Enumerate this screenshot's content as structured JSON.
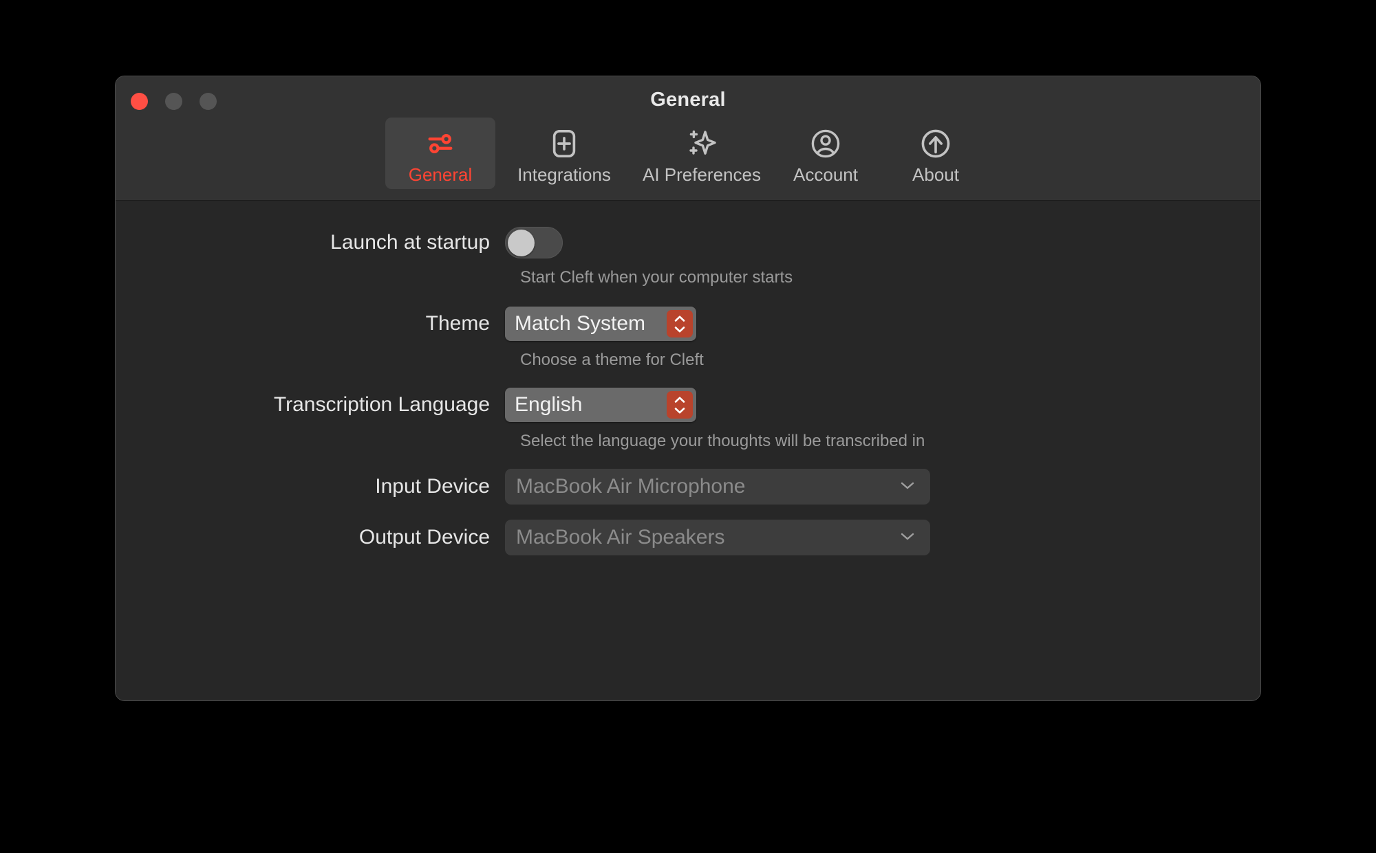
{
  "window": {
    "title": "General",
    "traffic_lights": [
      "close",
      "minimize",
      "maximize"
    ],
    "accent_color": "#ff4433",
    "stepper_color": "#b9432c"
  },
  "tabs": [
    {
      "label": "General",
      "icon": "sliders-icon",
      "active": true
    },
    {
      "label": "Integrations",
      "icon": "plus-square-icon",
      "active": false
    },
    {
      "label": "AI Preferences",
      "icon": "sparkles-icon",
      "active": false
    },
    {
      "label": "Account",
      "icon": "person-circle-icon",
      "active": false
    },
    {
      "label": "About",
      "icon": "arrow-up-circle-icon",
      "active": false
    }
  ],
  "settings": {
    "launch_at_startup": {
      "label": "Launch at startup",
      "toggle_state": "off",
      "helper": "Start Cleft when your computer starts"
    },
    "theme": {
      "label": "Theme",
      "value": "Match System",
      "helper": "Choose a theme for Cleft"
    },
    "transcription_language": {
      "label": "Transcription Language",
      "value": "English",
      "helper": "Select the language your thoughts will be transcribed in"
    },
    "input_device": {
      "label": "Input Device",
      "value": "MacBook Air Microphone",
      "disabled": true
    },
    "output_device": {
      "label": "Output Device",
      "value": "MacBook Air Speakers",
      "disabled": true
    }
  }
}
